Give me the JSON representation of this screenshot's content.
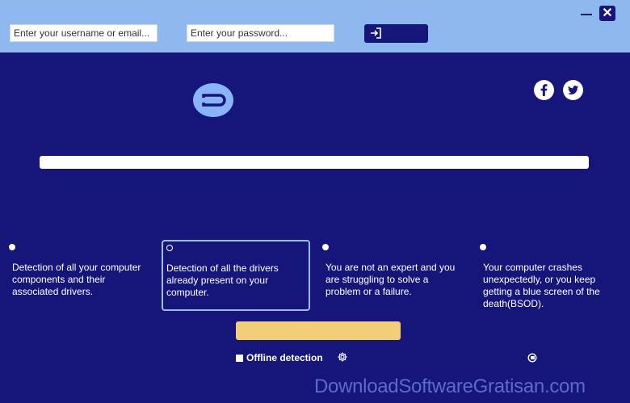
{
  "login": {
    "username_placeholder": "Enter your username or email...",
    "password_placeholder": "Enter your password..."
  },
  "window": {
    "close_glyph": "✕"
  },
  "colors": {
    "background": "#15157a",
    "topbar": "#8fb8ee",
    "action": "#f2cf76",
    "logo": "#8ab4f8"
  },
  "icons": {
    "login": "sign-in-icon",
    "facebook": "facebook-icon",
    "twitter": "twitter-icon",
    "settings": "gear-icon",
    "tool": "tool-icon"
  },
  "progress": {
    "value": 0
  },
  "features": [
    {
      "text": "Detection of all your computer components and their associated drivers.",
      "selected": false
    },
    {
      "text": "Detection of all the drivers already present on your computer.",
      "selected": true
    },
    {
      "text": "You are not an expert and you are struggling to solve a problem or a failure.",
      "selected": false
    },
    {
      "text": "Your computer crashes unexpectedly, or you keep getting a blue screen of the death(BSOD).",
      "selected": false
    }
  ],
  "offline": {
    "label": "Offline detection",
    "checked": false
  },
  "watermark": "DownloadSoftwareGratisan.com"
}
